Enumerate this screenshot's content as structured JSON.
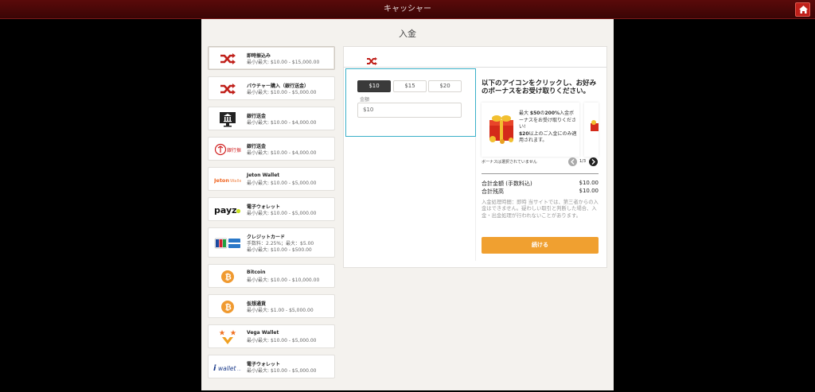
{
  "header": {
    "title": "キャッシャー"
  },
  "panel": {
    "title": "入金"
  },
  "methods": [
    {
      "name": "即時振込み",
      "lines": [
        "最小/最大: $10.00 - $15,000.00"
      ],
      "icon": "shuffle-icon"
    },
    {
      "name": "バウチャー購入（銀行送金）",
      "lines": [
        "最小/最大: $10.00 - $5,000.00"
      ],
      "icon": "shuffle-icon"
    },
    {
      "name": "銀行送金",
      "lines": [
        "最小/最大: $10.00 - $4,000.00"
      ],
      "icon": "bank-monitor-icon"
    },
    {
      "name": "銀行送金",
      "lines": [
        "最小/最大: $10.00 - $4,000.00"
      ],
      "icon": "bank-transfer-logo"
    },
    {
      "name": "Jeton Wallet",
      "lines": [
        "最小/最大: $10.00 - $5,000.00"
      ],
      "icon": "jeton-logo",
      "logo_text": "Jeton|Wallet"
    },
    {
      "name": "電子ウォレット",
      "lines": [
        "最小/最大: $10.00 - $5,000.00"
      ],
      "icon": "payz-logo",
      "logo_text": "payz"
    },
    {
      "name": "クレジットカード",
      "lines": [
        "手数料：2.25%；最大：$5.00",
        "最小/最大: $10.00 - $500.00"
      ],
      "icon": "credit-card-logo"
    },
    {
      "name": "Bitcoin",
      "lines": [
        "最小/最大: $10.00 - $10,000.00"
      ],
      "icon": "bitcoin-icon"
    },
    {
      "name": "仮想通貨",
      "lines": [
        "最小/最大: $1.00 - $5,000.00"
      ],
      "icon": "bitcoin-icon"
    },
    {
      "name": "Vega Wallet",
      "lines": [
        "最小/最大: $10.00 - $5,000.00"
      ],
      "icon": "vega-logo"
    },
    {
      "name": "電子ウォレット",
      "lines": [
        "最小/最大: $10.00 - $5,000.00"
      ],
      "icon": "iwallet-logo",
      "logo_text": "wallet"
    }
  ],
  "deposit": {
    "amount_options": [
      "$10",
      "$15",
      "$20"
    ],
    "selected_amount": "$10",
    "amount_label": "金額",
    "amount_value": "$10"
  },
  "bonus": {
    "title": "以下のアイコンをクリックし、お好みのボーナスをお受け取りください。",
    "card_text_1a": "最大 ",
    "card_text_1b": "$50",
    "card_text_1c": "の",
    "card_text_1d": "200%",
    "card_text_1e": "入金ボーナスをお受け取りください!",
    "card_text_2a": "$20",
    "card_text_2b": "以上のご入金にのみ適用されます。",
    "none_selected": "ボーナスは選択されていません",
    "pager": "1/3"
  },
  "summary": {
    "total_label": "合計金額 (手数料込)",
    "total_value": "$10.00",
    "balance_label": "合計残高",
    "balance_value": "$10.00",
    "info": "入金処理時間：即時 当サイトでは、第三者からの入金はできません。疑わしい取引と判断した場合、入金・出金処理が行われないことがあります。",
    "continue_label": "続ける"
  },
  "colors": {
    "header_bg": "#4a0808",
    "accent_orange": "#f0a030",
    "active_border": "#3ab0c8",
    "shuffle_red": "#c0201a",
    "bitcoin_orange": "#f09a30"
  }
}
